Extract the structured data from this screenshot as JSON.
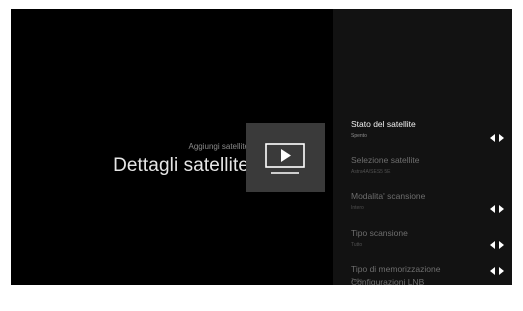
{
  "header": {
    "subtitle": "Aggiungi satellite",
    "title": "Dettagli satellite"
  },
  "icons": {
    "tile": "tv-play-icon",
    "arrows": "left-right-arrows-icon"
  },
  "colors": {
    "background": "#000000",
    "panel": "#121212",
    "tile": "#3a3a3a",
    "text": "#e6e6e6"
  },
  "settings": [
    {
      "label": "Stato del satellite",
      "value": "Spento"
    },
    {
      "label": "Selezione satellite",
      "value": "Astra4A/SES5 5E"
    },
    {
      "label": "Modalita' scansione",
      "value": "Intero"
    },
    {
      "label": "Tipo scansione",
      "value": "Tutto"
    },
    {
      "label": "Tipo di memorizzazione",
      "value": "Tutto"
    },
    {
      "label": "Configurazioni LNB",
      "value": ""
    }
  ]
}
